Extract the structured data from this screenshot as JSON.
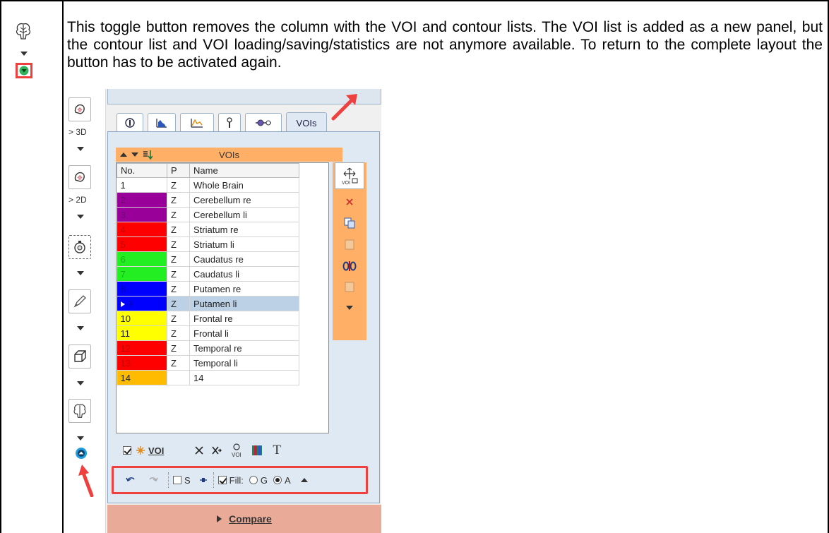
{
  "description": "This toggle button removes the column with the VOI and contour lists. The VOI list is added as a new panel, but the contour list and VOI loading/saving/statistics are not anymore available. To return to the complete layout the button has to be activated again.",
  "left_toolbar": {
    "label_3d": "> 3D",
    "label_2d": "> 2D"
  },
  "tabs": [
    {
      "icon": "info-icon",
      "label": ""
    },
    {
      "icon": "histogram-icon",
      "label": ""
    },
    {
      "icon": "curve-icon",
      "label": ""
    },
    {
      "icon": "pin-icon",
      "label": ""
    },
    {
      "icon": "slider-icon",
      "label": ""
    },
    {
      "icon": "",
      "label": "VOIs"
    }
  ],
  "voi_header": "VOIs",
  "table": {
    "columns": [
      "No.",
      "P",
      "Name"
    ],
    "rows": [
      {
        "no": "1",
        "p": "Z",
        "name": "Whole Brain",
        "color": "#ffffff",
        "selected": false
      },
      {
        "no": "2",
        "p": "Z",
        "name": "Cerebellum re",
        "color": "#990099",
        "selected": false
      },
      {
        "no": "3",
        "p": "Z",
        "name": "Cerebellum li",
        "color": "#990099",
        "selected": false
      },
      {
        "no": "4",
        "p": "Z",
        "name": "Striatum re",
        "color": "#ff0000",
        "selected": false
      },
      {
        "no": "5",
        "p": "Z",
        "name": "Striatum li",
        "color": "#ff0000",
        "selected": false
      },
      {
        "no": "6",
        "p": "Z",
        "name": "Caudatus re",
        "color": "#22ee22",
        "selected": false
      },
      {
        "no": "7",
        "p": "Z",
        "name": "Caudatus li",
        "color": "#22ee22",
        "selected": false
      },
      {
        "no": "8",
        "p": "Z",
        "name": "Putamen re",
        "color": "#0000ff",
        "selected": false
      },
      {
        "no": "9",
        "p": "Z",
        "name": "Putamen li",
        "color": "#0000ff",
        "selected": true
      },
      {
        "no": "10",
        "p": "Z",
        "name": "Frontal re",
        "color": "#ffff00",
        "selected": false
      },
      {
        "no": "11",
        "p": "Z",
        "name": "Frontal li",
        "color": "#ffff00",
        "selected": false
      },
      {
        "no": "12",
        "p": "Z",
        "name": "Temporal re",
        "color": "#ff0000",
        "selected": false
      },
      {
        "no": "13",
        "p": "Z",
        "name": "Temporal li",
        "color": "#ff0000",
        "selected": false
      },
      {
        "no": "14",
        "p": "",
        "name": "14",
        "color": "#ffbb00",
        "selected": false
      }
    ]
  },
  "bottom_tools": {
    "voi_label": "VOI",
    "text_tool": "T"
  },
  "undo_bar": {
    "s_label": "S",
    "fill_label": "Fill:",
    "g_label": "G",
    "a_label": "A"
  },
  "compare_label": "Compare",
  "colors": {
    "accent_orange": "#ffb066",
    "highlight_red": "#ef4040",
    "panel_blue": "#dfe9f3",
    "compare_bg": "#eaaa98"
  }
}
